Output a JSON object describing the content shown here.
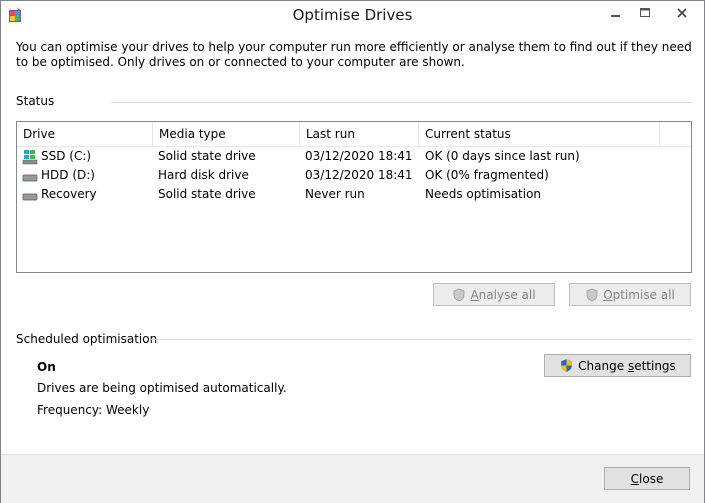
{
  "window": {
    "title": "Optimise Drives"
  },
  "intro": "You can optimise your drives to help your computer run more efficiently or analyse them to find out if they need to be optimised. Only drives on or connected to your computer are shown.",
  "status": {
    "label": "Status",
    "columns": [
      "Drive",
      "Media type",
      "Last run",
      "Current status"
    ],
    "drives": [
      {
        "name": "SSD (C:)",
        "media": "Solid state drive",
        "last_run": "03/12/2020 18:41",
        "status": "OK (0 days since last run)",
        "icon": "system-drive-icon"
      },
      {
        "name": "HDD (D:)",
        "media": "Hard disk drive",
        "last_run": "03/12/2020 18:41",
        "status": "OK (0% fragmented)",
        "icon": "hard-drive-icon"
      },
      {
        "name": "Recovery",
        "media": "Solid state drive",
        "last_run": "Never run",
        "status": "Needs optimisation",
        "icon": "hard-drive-icon"
      }
    ],
    "analyse_all": {
      "first": "A",
      "rest": "nalyse all"
    },
    "optimise_all": {
      "first": "O",
      "rest": "ptimise all"
    }
  },
  "scheduled": {
    "label": "Scheduled optimisation",
    "state": "On",
    "description": "Drives are being optimised automatically.",
    "frequency": "Frequency: Weekly",
    "change_settings": {
      "pre": "Change ",
      "key": "s",
      "post": "ettings"
    }
  },
  "footer": {
    "close": {
      "key": "C",
      "rest": "lose"
    }
  }
}
